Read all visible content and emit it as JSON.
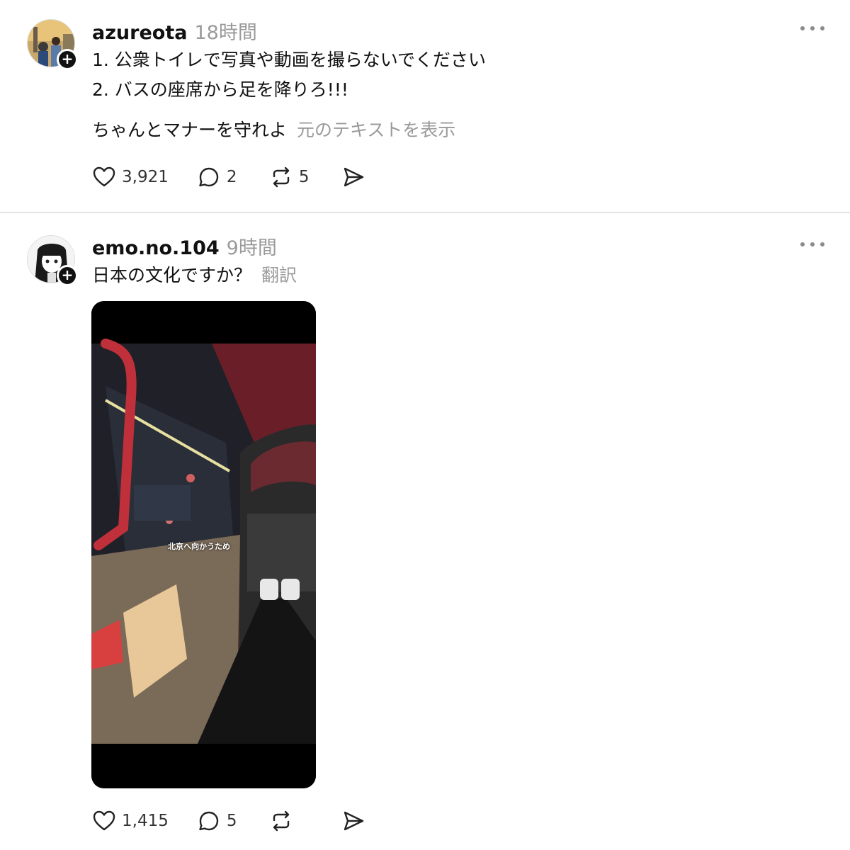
{
  "posts": [
    {
      "username": "azureota",
      "time": "18時間",
      "lines": [
        "1. 公衆トイレで写真や動画を撮らないでください",
        "2. バスの座席から足を降りろ!!!",
        "ちゃんとマナーを守れよ"
      ],
      "translate_label": "元のテキストを表示",
      "likes": "3,921",
      "comments": "2",
      "reposts": "5"
    },
    {
      "username": "emo.no.104",
      "time": "9時間",
      "text": "日本の文化ですか？",
      "translate_label": "翻訳",
      "video_caption": "北京へ向かうため",
      "likes": "1,415",
      "comments": "5",
      "reposts": ""
    }
  ],
  "icons": {
    "like": "heart-icon",
    "comment": "comment-icon",
    "repost": "repost-icon",
    "share": "share-icon",
    "more": "more-icon",
    "follow": "plus-icon"
  },
  "colors": {
    "text": "#111111",
    "muted": "#9a9a9a",
    "divider": "#e3e3e3"
  }
}
